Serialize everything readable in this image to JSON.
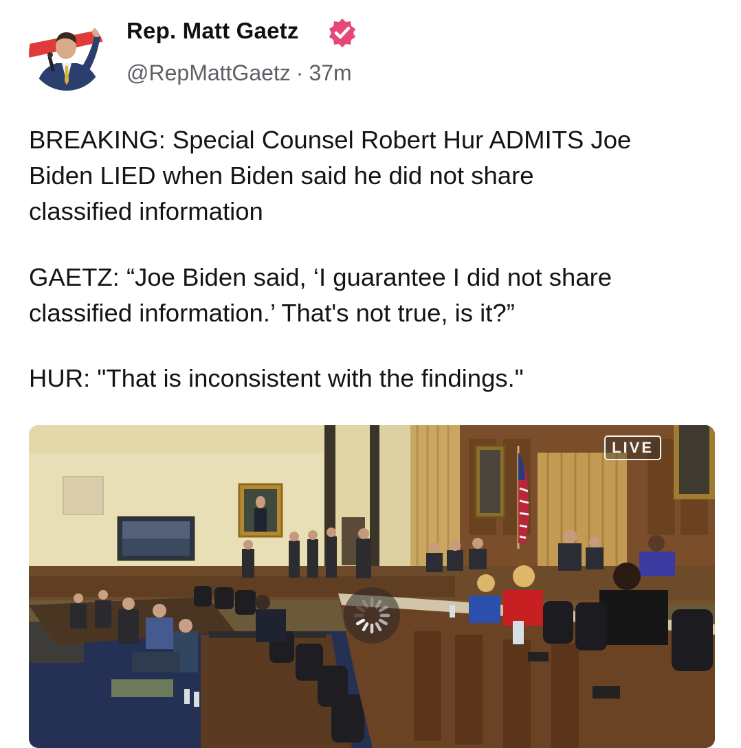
{
  "author": {
    "display_name": "Rep. Matt Gaetz",
    "handle": "@RepMattGaetz",
    "separator": "·",
    "time_ago": "37m",
    "verified": true,
    "avatar_icon": "profile-photo-icon",
    "badge_icon": "verified-badge-icon",
    "badge_color": "#e8477a"
  },
  "post": {
    "paragraphs": [
      "BREAKING: Special Counsel Robert Hur ADMITS Joe\nBiden LIED when Biden said he did not share\nclassified information",
      "GAETZ: “Joe Biden said, ‘I guarantee I did not share\nclassified information.’ That's not true, is it?”",
      "HUR: \"That is inconsistent with the findings.\""
    ]
  },
  "media": {
    "type": "video",
    "live_label": "LIVE",
    "spinner_icon": "loading-spinner-icon",
    "scene_icon": "hearing-room-video-frame"
  }
}
